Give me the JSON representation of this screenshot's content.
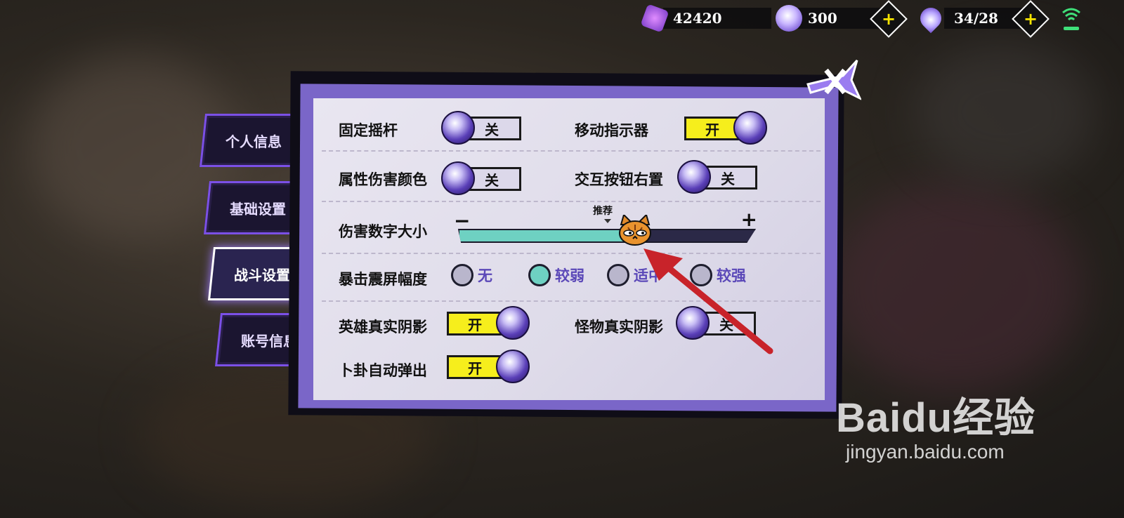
{
  "resources": {
    "crystal": "42420",
    "orb": "300",
    "stamina": "34/28"
  },
  "tabs": [
    "个人信息",
    "基础设置",
    "战斗设置",
    "账号信息"
  ],
  "active_tab": "战斗设置",
  "settings": {
    "fixed_joystick": {
      "label": "固定摇杆",
      "state": "关"
    },
    "move_indicator": {
      "label": "移动指示器",
      "state": "开"
    },
    "attr_damage_color": {
      "label": "属性伤害颜色",
      "state": "关"
    },
    "interact_button_right": {
      "label": "交互按钮右置",
      "state": "关"
    },
    "damage_number_size": {
      "label": "伤害数字大小",
      "minus": "−",
      "plus": "+",
      "recommend": "推荐",
      "value_fraction": 0.6
    },
    "crit_shake": {
      "label": "暴击震屏幅度",
      "options": [
        "无",
        "较弱",
        "适中",
        "较强"
      ],
      "selected": "较弱"
    },
    "hero_shadow": {
      "label": "英雄真实阴影",
      "state": "开"
    },
    "monster_shadow": {
      "label": "怪物真实阴影",
      "state": "关"
    },
    "divination_popup": {
      "label": "卜卦自动弹出",
      "state": "开"
    }
  },
  "watermark": {
    "brand": "Baidu经验",
    "url": "jingyan.baidu.com"
  }
}
